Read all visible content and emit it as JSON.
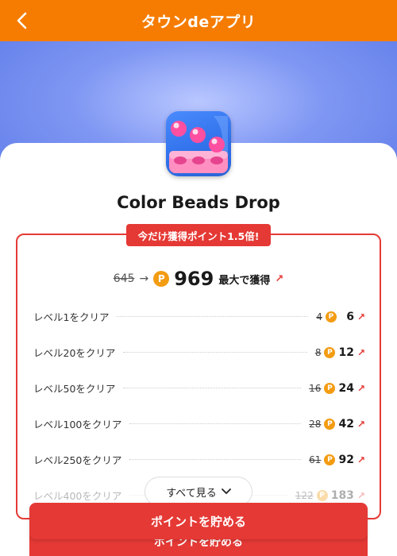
{
  "header": {
    "title": "タウンdeアプリ",
    "back_icon": "chevron-left-icon",
    "background": "#f57c00"
  },
  "app": {
    "name": "Color Beads Drop",
    "icon": "color-beads-app-icon"
  },
  "promo": {
    "badge": "今だけ獲得ポイント1.5倍!",
    "accent": "#e53935"
  },
  "total": {
    "old_points": "645",
    "arrow": "→",
    "new_points": "969",
    "suffix": "最大で獲得",
    "up_arrow": "↗",
    "coin_label": "P"
  },
  "tasks": [
    {
      "label": "レベル1をクリア",
      "old": "4",
      "new": "6"
    },
    {
      "label": "レベル20をクリア",
      "old": "8",
      "new": "12"
    },
    {
      "label": "レベル50をクリア",
      "old": "16",
      "new": "24"
    },
    {
      "label": "レベル100をクリア",
      "old": "28",
      "new": "42"
    },
    {
      "label": "レベル250をクリア",
      "old": "61",
      "new": "92"
    },
    {
      "label": "レベル400をクリア",
      "old": "122",
      "new": "183"
    }
  ],
  "see_all": {
    "label": "すべて見る",
    "icon": "chevron-down-icon"
  },
  "cta": {
    "label": "ポイントを貯める"
  }
}
